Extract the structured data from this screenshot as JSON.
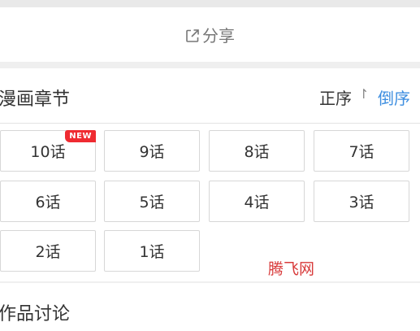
{
  "share": {
    "icon": "share-external-icon",
    "label": "分享"
  },
  "chapters": {
    "title": "漫画章节",
    "sort_asc_label": "正序",
    "sort_asc_arrow": "↾",
    "sort_desc_label": "倒序",
    "new_badge": "NEW",
    "items": [
      {
        "label": "10话",
        "is_new": true
      },
      {
        "label": "9话",
        "is_new": false
      },
      {
        "label": "8话",
        "is_new": false
      },
      {
        "label": "7话",
        "is_new": false
      },
      {
        "label": "6话",
        "is_new": false
      },
      {
        "label": "5话",
        "is_new": false
      },
      {
        "label": "4话",
        "is_new": false
      },
      {
        "label": "3话",
        "is_new": false
      },
      {
        "label": "2话",
        "is_new": false
      },
      {
        "label": "1话",
        "is_new": false
      }
    ]
  },
  "watermark": "腾飞网",
  "discussion": {
    "title": "作品讨论"
  },
  "colors": {
    "accent_blue": "#3d8ee0",
    "badge_red": "#ef2b31",
    "watermark_red": "#d83a3a"
  }
}
